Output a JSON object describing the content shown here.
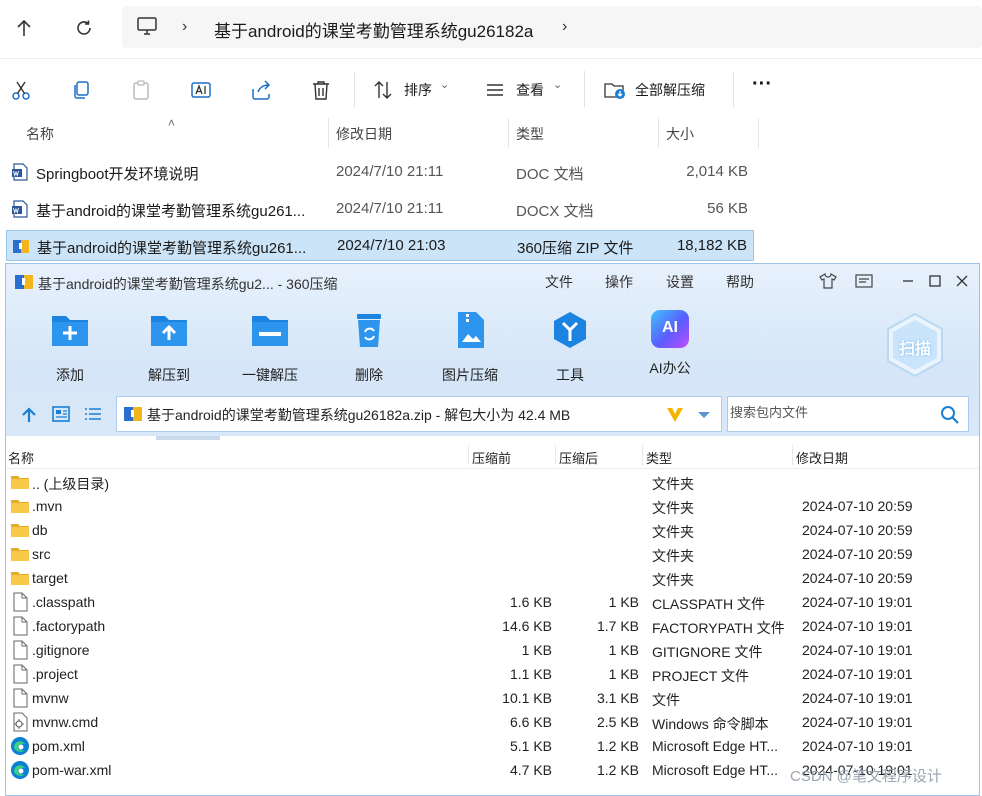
{
  "explorer": {
    "breadcrumb": "基于android的课堂考勤管理系统gu26182a",
    "toolbar": {
      "sort_label": "排序",
      "view_label": "查看",
      "extract_all_label": "全部解压缩",
      "more_label": "···"
    },
    "columns": {
      "name": "名称",
      "modified": "修改日期",
      "type": "类型",
      "size": "大小"
    },
    "files": [
      {
        "name": "Springboot开发环境说明",
        "modified": "2024/7/10 21:11",
        "type": "DOC 文档",
        "size": "2,014 KB",
        "icon": "word-doc-icon"
      },
      {
        "name": "基于android的课堂考勤管理系统gu261...",
        "modified": "2024/7/10 21:11",
        "type": "DOCX 文档",
        "size": "56 KB",
        "icon": "word-doc-icon"
      },
      {
        "name": "基于android的课堂考勤管理系统gu261...",
        "modified": "2024/7/10 21:03",
        "type": "360压缩 ZIP 文件",
        "size": "18,182 KB",
        "icon": "zip-archive-icon"
      }
    ]
  },
  "zip_window": {
    "title": "基于android的课堂考勤管理系统gu2... - 360压缩",
    "menu": [
      "文件",
      "操作",
      "设置",
      "帮助"
    ],
    "tools": [
      "添加",
      "解压到",
      "一键解压",
      "删除",
      "图片压缩",
      "工具",
      "AI办公"
    ],
    "ai_badge": "AI",
    "scan_label": "扫描",
    "path": "基于android的课堂考勤管理系统gu26182a.zip - 解包大小为 42.4 MB",
    "search_placeholder": "搜索包内文件",
    "columns": {
      "name": "名称",
      "before": "压缩前",
      "after": "压缩后",
      "type": "类型",
      "modified": "修改日期"
    },
    "rows": [
      {
        "name": ".. (上级目录)",
        "before": "",
        "after": "",
        "type": "文件夹",
        "modified": "",
        "icon": "folder"
      },
      {
        "name": ".mvn",
        "before": "",
        "after": "",
        "type": "文件夹",
        "modified": "2024-07-10 20:59",
        "icon": "folder"
      },
      {
        "name": "db",
        "before": "",
        "after": "",
        "type": "文件夹",
        "modified": "2024-07-10 20:59",
        "icon": "folder"
      },
      {
        "name": "src",
        "before": "",
        "after": "",
        "type": "文件夹",
        "modified": "2024-07-10 20:59",
        "icon": "folder"
      },
      {
        "name": "target",
        "before": "",
        "after": "",
        "type": "文件夹",
        "modified": "2024-07-10 20:59",
        "icon": "folder"
      },
      {
        "name": ".classpath",
        "before": "1.6 KB",
        "after": "1 KB",
        "type": "CLASSPATH 文件",
        "modified": "2024-07-10 19:01",
        "icon": "file"
      },
      {
        "name": ".factorypath",
        "before": "14.6 KB",
        "after": "1.7 KB",
        "type": "FACTORYPATH 文件",
        "modified": "2024-07-10 19:01",
        "icon": "file"
      },
      {
        "name": ".gitignore",
        "before": "1 KB",
        "after": "1 KB",
        "type": "GITIGNORE 文件",
        "modified": "2024-07-10 19:01",
        "icon": "file"
      },
      {
        "name": ".project",
        "before": "1.1 KB",
        "after": "1 KB",
        "type": "PROJECT 文件",
        "modified": "2024-07-10 19:01",
        "icon": "file"
      },
      {
        "name": "mvnw",
        "before": "10.1 KB",
        "after": "3.1 KB",
        "type": "文件",
        "modified": "2024-07-10 19:01",
        "icon": "file"
      },
      {
        "name": "mvnw.cmd",
        "before": "6.6 KB",
        "after": "2.5 KB",
        "type": "Windows 命令脚本",
        "modified": "2024-07-10 19:01",
        "icon": "cmd"
      },
      {
        "name": "pom.xml",
        "before": "5.1 KB",
        "after": "1.2 KB",
        "type": "Microsoft Edge HT...",
        "modified": "2024-07-10 19:01",
        "icon": "edge"
      },
      {
        "name": "pom-war.xml",
        "before": "4.7 KB",
        "after": "1.2 KB",
        "type": "Microsoft Edge HT...",
        "modified": "2024-07-10 19:01",
        "icon": "edge"
      }
    ]
  },
  "watermark": "CSDN @笔文程序设计",
  "colors": {
    "selection": "#cce4f7",
    "accent": "#1a7fd4",
    "folder": "#f5c342"
  }
}
